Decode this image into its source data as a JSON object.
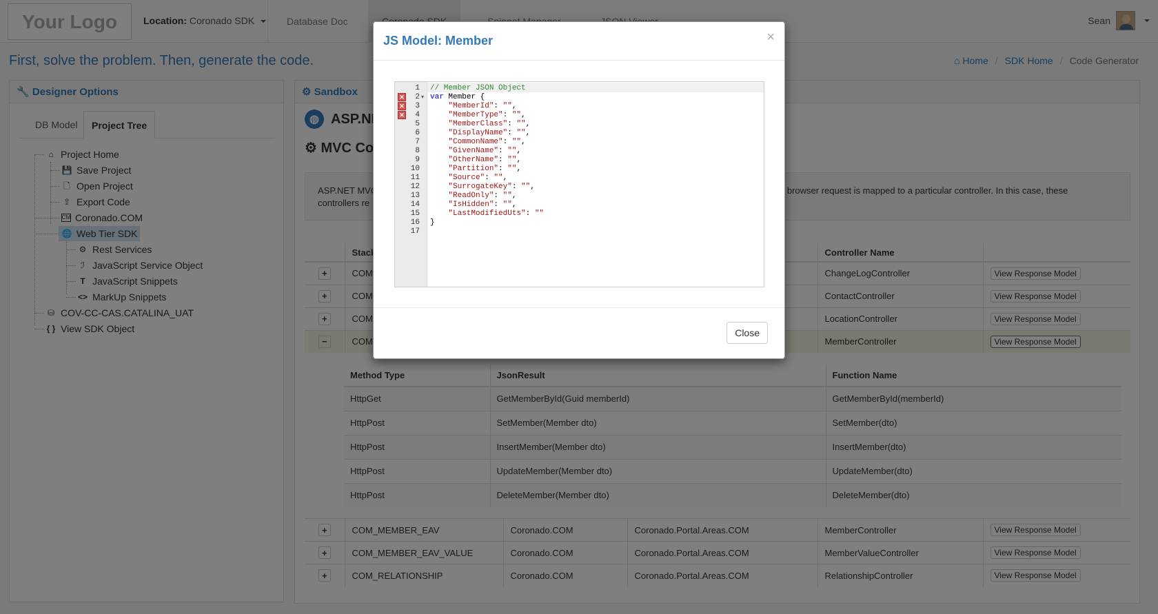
{
  "navbar": {
    "logo": "Your Logo",
    "location_label": "Location:",
    "location_value": "Coronado SDK",
    "tabs": [
      "Database Doc",
      "Coronado SDK",
      "Snippet Manager",
      "JSON Viewer"
    ],
    "user_name": "Sean"
  },
  "header": {
    "tagline": "First, solve the problem. Then, generate the code.",
    "breadcrumb": [
      "Home",
      "SDK Home",
      "Code Generator"
    ]
  },
  "left_panel": {
    "title": "Designer Options",
    "tabs": [
      "DB Model",
      "Project Tree"
    ],
    "tree": [
      {
        "label": "Project Home",
        "icon": "home-icon"
      },
      {
        "label": "Save Project",
        "icon": "floppy-icon"
      },
      {
        "label": "Open Project",
        "icon": "file-icon"
      },
      {
        "label": "Export Code",
        "icon": "export-icon"
      },
      {
        "label": "Coronado.COM",
        "icon": "cm-icon"
      },
      {
        "label": "Web Tier SDK",
        "icon": "globe-icon"
      },
      {
        "label": "Rest Services",
        "icon": "gear-icon"
      },
      {
        "label": "JavaScript Service Object",
        "icon": "js-icon"
      },
      {
        "label": "JavaScript Snippets",
        "icon": "text-icon"
      },
      {
        "label": "MarkUp Snippets",
        "icon": "code-icon"
      },
      {
        "label": "COV-CC-CAS.CATALINA_UAT",
        "icon": "database-icon"
      },
      {
        "label": "View SDK Object",
        "icon": "braces-icon"
      }
    ]
  },
  "right_panel": {
    "title": "Sandbox",
    "asp_title": "ASP.NE",
    "mvc_title": "MVC Co",
    "well_text_left": "ASP.NET MVC",
    "well_text_left2": "controllers re",
    "well_text_right": "h browser request is mapped to a particular controller. In this case, these",
    "headers": [
      "",
      "Stack",
      "",
      "",
      "Controller Name",
      ""
    ],
    "rows": [
      {
        "toggle": "+",
        "stack": "COM",
        "controller": "ChangeLogController",
        "button": "View Response Model"
      },
      {
        "toggle": "+",
        "stack": "COM",
        "controller": "ContactController",
        "button": "View Response Model"
      },
      {
        "toggle": "+",
        "stack": "COM",
        "controller": "LocationController",
        "button": "View Response Model"
      },
      {
        "toggle": "−",
        "stack": "COM",
        "controller": "MemberController",
        "button": "View Response Model"
      }
    ],
    "sub_headers": [
      "Method Type",
      "JsonResult",
      "Function Name"
    ],
    "sub_rows": [
      [
        "HttpGet",
        "GetMemberById(Guid memberId)",
        "GetMemberById(memberId)"
      ],
      [
        "HttpPost",
        "SetMember(Member dto)",
        "SetMember(dto)"
      ],
      [
        "HttpPost",
        "InsertMember(Member dto)",
        "InsertMember(dto)"
      ],
      [
        "HttpPost",
        "UpdateMember(Member dto)",
        "UpdateMember(dto)"
      ],
      [
        "HttpPost",
        "DeleteMember(Member dto)",
        "DeleteMember(dto)"
      ]
    ],
    "lower_rows": [
      {
        "toggle": "+",
        "stack": "COM_MEMBER_EAV",
        "assembly": "Coronado.COM",
        "namespace": "Coronado.Portal.Areas.COM",
        "controller": "MemberController",
        "button": "View Response Model"
      },
      {
        "toggle": "+",
        "stack": "COM_MEMBER_EAV_VALUE",
        "assembly": "Coronado.COM",
        "namespace": "Coronado.Portal.Areas.COM",
        "controller": "MemberValueController",
        "button": "View Response Model"
      },
      {
        "toggle": "+",
        "stack": "COM_RELATIONSHIP",
        "assembly": "Coronado.COM",
        "namespace": "Coronado.Portal.Areas.COM",
        "controller": "RelationshipController",
        "button": "View Response Model"
      }
    ]
  },
  "modal": {
    "title": "JS Model: Member",
    "close_x": "×",
    "close_button": "Close",
    "code_lines": [
      "// Member JSON Object",
      "var Member {",
      "    \"MemberId\": \"\",",
      "    \"MemberType\": \"\",",
      "    \"MemberClass\": \"\",",
      "    \"DisplayName\": \"\",",
      "    \"CommonName\": \"\",",
      "    \"GivenName\": \"\",",
      "    \"OtherName\": \"\",",
      "    \"Partition\": \"\",",
      "    \"Source\": \"\",",
      "    \"SurrogateKey\": \"\",",
      "    \"ReadOnly\": \"\",",
      "    \"IsHidden\": \"\",",
      "    \"LastModifiedUts\": \"\"",
      "}",
      ""
    ],
    "error_lines": [
      2,
      3,
      4
    ]
  },
  "colors": {
    "brand": "#337ab7",
    "highlight_row": "#f0f7e1",
    "error": "#d9534f"
  }
}
